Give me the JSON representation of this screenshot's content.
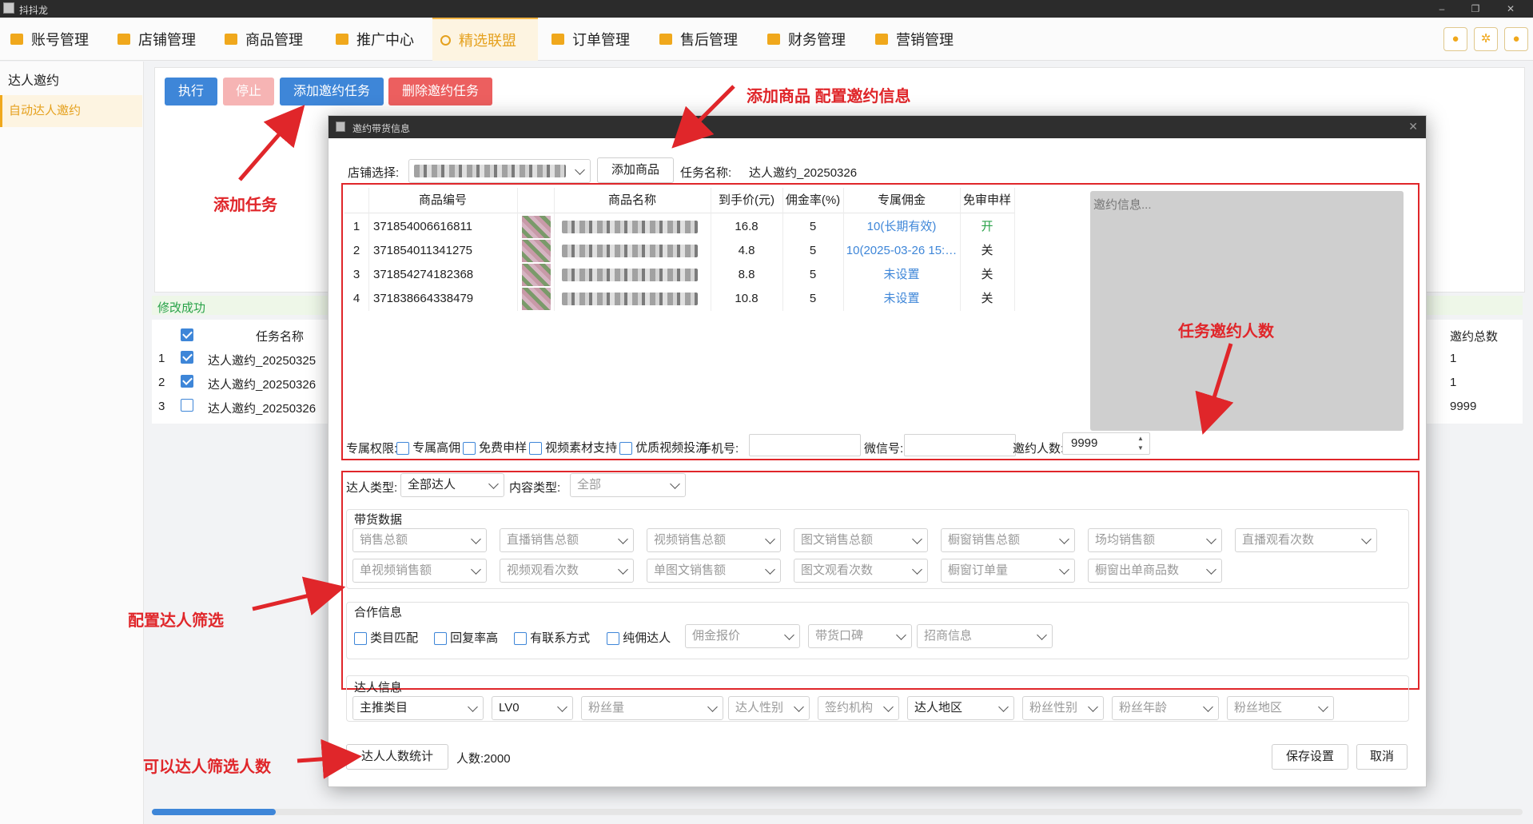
{
  "app": {
    "title": "抖抖龙"
  },
  "nav": {
    "tabs": [
      {
        "label": "账号管理"
      },
      {
        "label": "店铺管理"
      },
      {
        "label": "商品管理"
      },
      {
        "label": "推广中心"
      },
      {
        "label": "精选联盟",
        "active": true
      },
      {
        "label": "订单管理"
      },
      {
        "label": "售后管理"
      },
      {
        "label": "财务管理"
      },
      {
        "label": "营销管理"
      }
    ],
    "accent_color": "#f0a81c"
  },
  "sidebar": {
    "heading": "达人邀约",
    "items": [
      {
        "label": "自动达人邀约",
        "active": true
      }
    ]
  },
  "toolbar": {
    "run": "执行",
    "stop": "停止",
    "add": "添加邀约任务",
    "delete": "删除邀约任务"
  },
  "status": {
    "message": "修改成功"
  },
  "task_table": {
    "headers": {
      "name": "任务名称",
      "total": "邀约总数"
    },
    "rows": [
      {
        "index": "1",
        "checked": true,
        "name": "达人邀约_20250325",
        "total": "1"
      },
      {
        "index": "2",
        "checked": true,
        "name": "达人邀约_20250326",
        "total": "1"
      },
      {
        "index": "3",
        "checked": false,
        "name": "达人邀约_20250326",
        "total": "9999"
      }
    ]
  },
  "annotations": {
    "add_task": "添加任务",
    "add_product": "添加商品 配置邀约信息",
    "invite_count": "任务邀约人数",
    "filter": "配置达人筛选",
    "count_stat": "可以达人筛选人数"
  },
  "dialog": {
    "title": "邀约带货信息",
    "shop_label": "店铺选择:",
    "add_product_button": "添加商品",
    "task_name_label": "任务名称:",
    "task_name_value": "达人邀约_20250326",
    "product_table": {
      "headers": [
        "商品编号",
        "商品名称",
        "到手价(元)",
        "佣金率(%)",
        "专属佣金",
        "免审申样"
      ],
      "rows": [
        {
          "index": "1",
          "id": "371854006616811",
          "price": "16.8",
          "rate": "5",
          "commission": "10(长期有效)",
          "sample": "开"
        },
        {
          "index": "2",
          "id": "371854011341275",
          "price": "4.8",
          "rate": "5",
          "commission": "10(2025-03-26 15:…",
          "sample": "关"
        },
        {
          "index": "3",
          "id": "371854274182368",
          "price": "8.8",
          "rate": "5",
          "commission": "未设置",
          "sample": "关"
        },
        {
          "index": "4",
          "id": "371838664338479",
          "price": "10.8",
          "rate": "5",
          "commission": "未设置",
          "sample": "关"
        }
      ]
    },
    "invite_info_placeholder": "邀约信息...",
    "perm_label": "专属权限:",
    "perms": [
      "专属高佣",
      "免费申样",
      "视频素材支持",
      "优质视频投流"
    ],
    "phone_label": "手机号:",
    "wechat_label": "微信号:",
    "invite_count_label": "邀约人数:",
    "invite_count_value": "9999",
    "influencer_type_label": "达人类型:",
    "influencer_type_value": "全部达人",
    "content_type_label": "内容类型:",
    "content_type_value": "全部",
    "sales_section": {
      "title": "带货数据",
      "row1": [
        "销售总额",
        "直播销售总额",
        "视频销售总额",
        "图文销售总额",
        "橱窗销售总额",
        "场均销售额",
        "直播观看次数"
      ],
      "row2": [
        "单视频销售额",
        "视频观看次数",
        "单图文销售额",
        "图文观看次数",
        "橱窗订单量",
        "橱窗出单商品数"
      ]
    },
    "coop_section": {
      "title": "合作信息",
      "checks": [
        "类目匹配",
        "回复率高",
        "有联系方式",
        "纯佣达人"
      ],
      "selects": [
        "佣金报价",
        "带货口碑",
        "招商信息"
      ]
    },
    "info_section": {
      "title": "达人信息",
      "selects": [
        {
          "label": "主推类目",
          "dim": false
        },
        {
          "label": "LV0",
          "dim": false
        },
        {
          "label": "粉丝量",
          "dim": true
        },
        {
          "label": "达人性别",
          "dim": true
        },
        {
          "label": "签约机构",
          "dim": true
        },
        {
          "label": "达人地区",
          "dim": false
        },
        {
          "label": "粉丝性别",
          "dim": true
        },
        {
          "label": "粉丝年龄",
          "dim": true
        },
        {
          "label": "粉丝地区",
          "dim": true
        }
      ]
    },
    "count_button": "达人人数统计",
    "count_result": "人数:2000",
    "save_button": "保存设置",
    "cancel_button": "取消"
  }
}
